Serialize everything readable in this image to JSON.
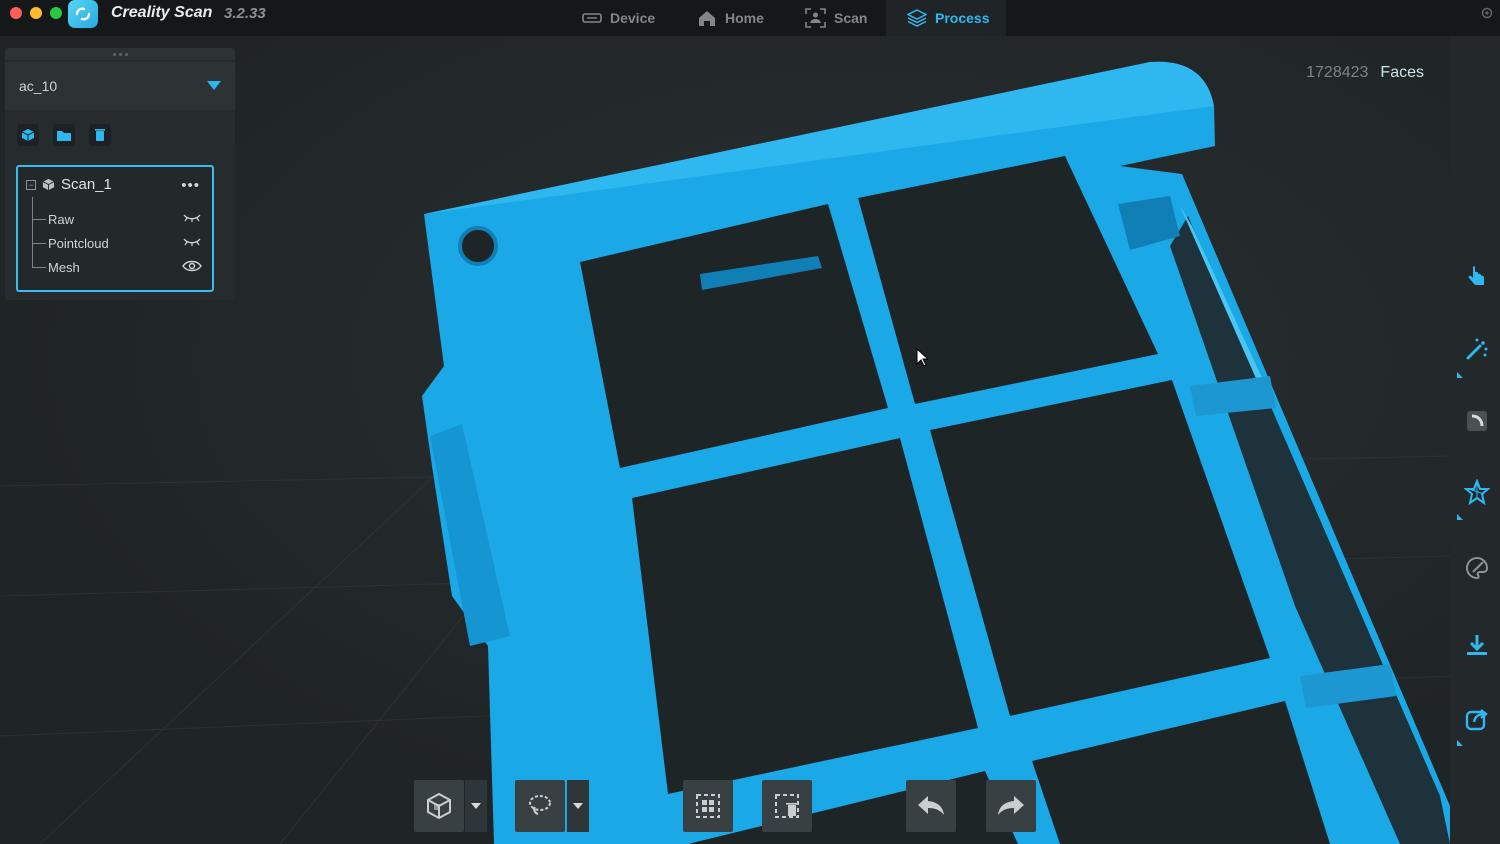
{
  "window": {
    "app_name": "Creality Scan",
    "version": "3.2.33"
  },
  "nav": {
    "tabs": [
      {
        "label": "Device",
        "icon": "device-icon"
      },
      {
        "label": "Home",
        "icon": "home-icon"
      },
      {
        "label": "Scan",
        "icon": "scan-icon"
      },
      {
        "label": "Process",
        "icon": "layers-icon",
        "active": true
      }
    ]
  },
  "viewport": {
    "face_count": "1728423",
    "face_label": "Faces"
  },
  "project": {
    "name": "ac_10"
  },
  "tree": {
    "root_label": "Scan_1",
    "more_label": "•••",
    "items": [
      {
        "label": "Raw",
        "visibility": "hidden"
      },
      {
        "label": "Pointcloud",
        "visibility": "hidden"
      },
      {
        "label": "Mesh",
        "visibility": "visible"
      }
    ]
  },
  "colors": {
    "accent": "#2fb8f0",
    "model": "#1aa9e6",
    "background": "#1f2426"
  }
}
